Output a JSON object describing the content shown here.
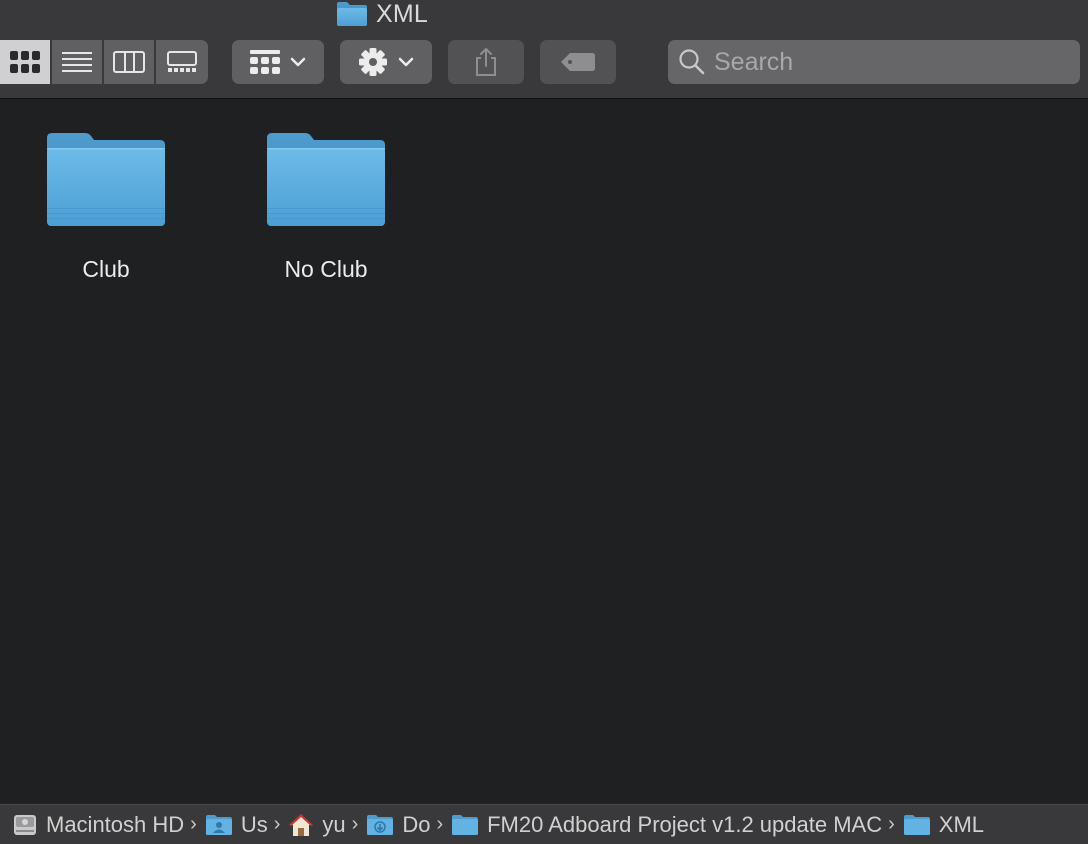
{
  "window": {
    "title": "XML"
  },
  "toolbar": {
    "view_buttons": [
      {
        "name": "icon-view-button",
        "active": true
      },
      {
        "name": "list-view-button",
        "active": false
      },
      {
        "name": "column-view-button",
        "active": false
      },
      {
        "name": "gallery-view-button",
        "active": false
      }
    ],
    "group_button": {
      "icon": "group-grid-icon",
      "chevron": "chevron-down-icon"
    },
    "action_button": {
      "icon": "gear-icon",
      "chevron": "chevron-down-icon"
    },
    "share_button": {
      "icon": "share-icon"
    },
    "tag_button": {
      "icon": "tag-icon"
    },
    "search": {
      "placeholder": "Search",
      "value": ""
    }
  },
  "items": [
    {
      "label": "Club",
      "icon": "folder-icon"
    },
    {
      "label": "No Club",
      "icon": "folder-icon"
    }
  ],
  "path_bar": {
    "crumbs": [
      {
        "label": "Macintosh HD",
        "icon": "hard-drive-icon"
      },
      {
        "label": "Us",
        "icon": "users-folder-icon"
      },
      {
        "label": "yu",
        "icon": "home-icon"
      },
      {
        "label": "Do",
        "icon": "downloads-folder-icon"
      },
      {
        "label": "FM20 Adboard Project v1.2 update MAC",
        "icon": "folder-icon"
      },
      {
        "label": "XML",
        "icon": "folder-icon"
      }
    ]
  },
  "colors": {
    "window_bg": "#1f2022",
    "toolbar_bg": "#39393b",
    "button_bg": "#606062",
    "folder_blue": "#5aaee0"
  }
}
